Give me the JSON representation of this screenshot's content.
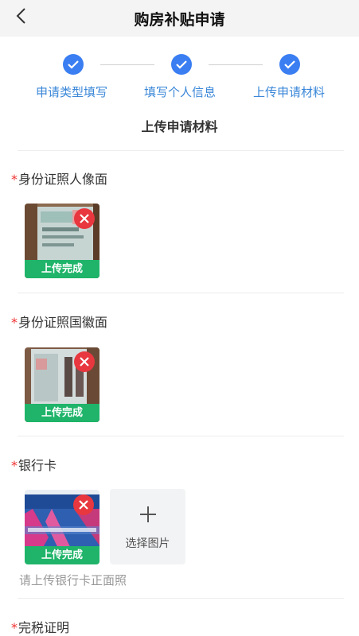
{
  "header": {
    "title": "购房补贴申请",
    "back_icon": "chevron-left-icon"
  },
  "steps": [
    {
      "label": "申请类型填写",
      "done": true
    },
    {
      "label": "填写个人信息",
      "done": true
    },
    {
      "label": "上传申请材料",
      "done": true
    }
  ],
  "section_title": "上传申请材料",
  "fields": [
    {
      "required_mark": "*",
      "label": "身份证照人像面",
      "upload_status": "上传完成"
    },
    {
      "required_mark": "*",
      "label": "身份证照国徽面",
      "upload_status": "上传完成"
    },
    {
      "required_mark": "*",
      "label": "银行卡",
      "upload_status": "上传完成",
      "picker_label": "选择图片",
      "hint": "请上传银行卡正面照"
    },
    {
      "required_mark": "*",
      "label": "完税证明"
    }
  ],
  "colors": {
    "accent": "#3a7ef2",
    "step_label": "#3a87d8",
    "success": "#1fb46a",
    "delete": "#e8373f",
    "required": "#e33"
  }
}
